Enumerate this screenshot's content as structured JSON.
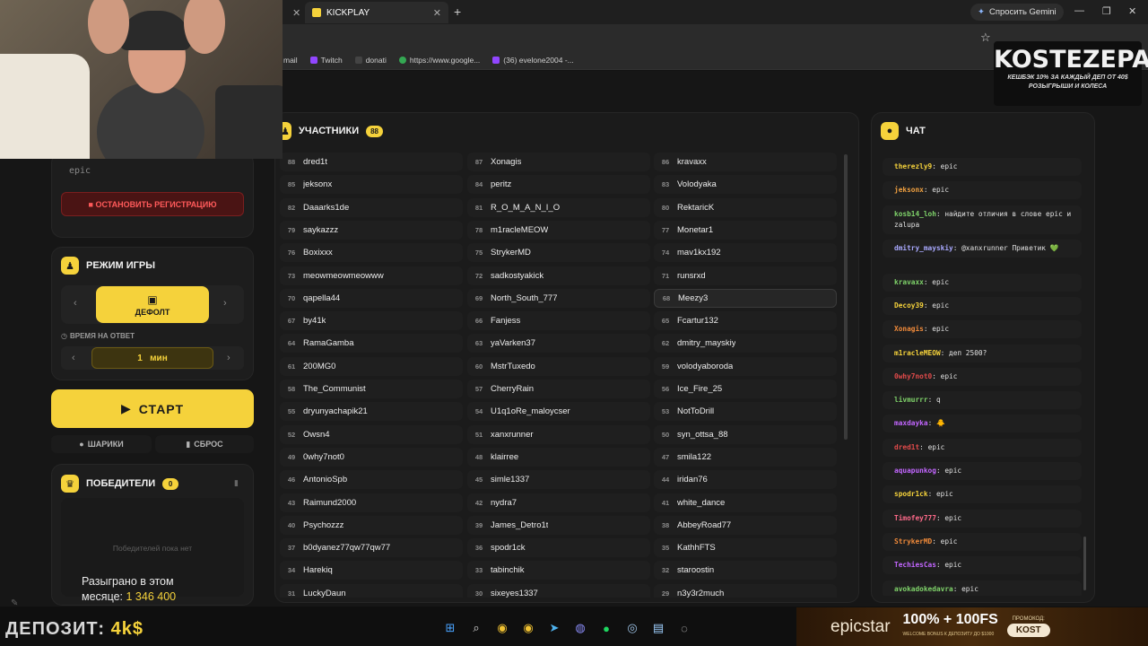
{
  "browser": {
    "tab_title": "KICKPLAY",
    "gemini_label": "Спросить Gemini",
    "bookmarks": [
      {
        "label": "mail"
      },
      {
        "label": "Twitch"
      },
      {
        "label": "donati"
      },
      {
        "label": "https://www.google..."
      },
      {
        "label": "(36) evelone2004 -..."
      }
    ]
  },
  "registration": {
    "last_message": "epic",
    "stop_label": "■ ОСТАНОВИТЬ РЕГИСТРАЦИЮ"
  },
  "game_mode": {
    "title": "РЕЖИМ ИГРЫ",
    "selected": "ДЕФОЛТ",
    "response_time_label": "ВРЕМЯ НА ОТВЕТ",
    "response_time": "1   мин"
  },
  "controls": {
    "start_label": "СТАРТ",
    "balls_label": "ШАРИКИ",
    "reset_label": "СБРОС"
  },
  "winners": {
    "title": "ПОБЕДИТЕЛИ",
    "count": "0",
    "empty_text": "Победителей пока нет",
    "played_line1": "Разыграно в этом",
    "played_line2": "месяце:",
    "played_amount": "1 346 400"
  },
  "participants": {
    "title": "УЧАСТНИКИ",
    "count": "88",
    "highlighted": "68",
    "rows": [
      [
        {
          "n": "88",
          "name": "dred1t"
        },
        {
          "n": "87",
          "name": "Xonagis"
        },
        {
          "n": "86",
          "name": "kravaxx"
        }
      ],
      [
        {
          "n": "85",
          "name": "jeksonx"
        },
        {
          "n": "84",
          "name": "peritz"
        },
        {
          "n": "83",
          "name": "Volodyaka"
        }
      ],
      [
        {
          "n": "82",
          "name": "Daaarks1de"
        },
        {
          "n": "81",
          "name": "R_O_M_A_N_I_O"
        },
        {
          "n": "80",
          "name": "RektaricK"
        }
      ],
      [
        {
          "n": "79",
          "name": "saykazzz"
        },
        {
          "n": "78",
          "name": "m1racleMEOW"
        },
        {
          "n": "77",
          "name": "Monetar1"
        }
      ],
      [
        {
          "n": "76",
          "name": "Boxixxx"
        },
        {
          "n": "75",
          "name": "StrykerMD"
        },
        {
          "n": "74",
          "name": "mav1kx192"
        }
      ],
      [
        {
          "n": "73",
          "name": "meowmeowmeowww"
        },
        {
          "n": "72",
          "name": "sadkostyakick"
        },
        {
          "n": "71",
          "name": "runsrxd"
        }
      ],
      [
        {
          "n": "70",
          "name": "qapella44"
        },
        {
          "n": "69",
          "name": "North_South_777"
        },
        {
          "n": "68",
          "name": "Meezy3"
        }
      ],
      [
        {
          "n": "67",
          "name": "by41k"
        },
        {
          "n": "66",
          "name": "Fanjess"
        },
        {
          "n": "65",
          "name": "Fcartur132"
        }
      ],
      [
        {
          "n": "64",
          "name": "RamaGamba"
        },
        {
          "n": "63",
          "name": "yaVarken37"
        },
        {
          "n": "62",
          "name": "dmitry_mayskiy"
        }
      ],
      [
        {
          "n": "61",
          "name": "200MG0"
        },
        {
          "n": "60",
          "name": "MstrTuxedo"
        },
        {
          "n": "59",
          "name": "volodyaboroda"
        }
      ],
      [
        {
          "n": "58",
          "name": "The_Communist"
        },
        {
          "n": "57",
          "name": "CherryRain"
        },
        {
          "n": "56",
          "name": "Ice_Fire_25"
        }
      ],
      [
        {
          "n": "55",
          "name": "dryunyachapik21"
        },
        {
          "n": "54",
          "name": "U1q1oRe_maloycser"
        },
        {
          "n": "53",
          "name": "NotToDrill"
        }
      ],
      [
        {
          "n": "52",
          "name": "Owsn4"
        },
        {
          "n": "51",
          "name": "xanxrunner"
        },
        {
          "n": "50",
          "name": "syn_ottsa_88"
        }
      ],
      [
        {
          "n": "49",
          "name": "0why7not0"
        },
        {
          "n": "48",
          "name": "klairree"
        },
        {
          "n": "47",
          "name": "smila122"
        }
      ],
      [
        {
          "n": "46",
          "name": "AntonioSpb"
        },
        {
          "n": "45",
          "name": "simle1337"
        },
        {
          "n": "44",
          "name": "iridan76"
        }
      ],
      [
        {
          "n": "43",
          "name": "Raimund2000"
        },
        {
          "n": "42",
          "name": "nydra7"
        },
        {
          "n": "41",
          "name": "white_dance"
        }
      ],
      [
        {
          "n": "40",
          "name": "Psychozzz"
        },
        {
          "n": "39",
          "name": "James_Detro1t"
        },
        {
          "n": "38",
          "name": "AbbeyRoad77"
        }
      ],
      [
        {
          "n": "37",
          "name": "b0dyanez77qw77qw77"
        },
        {
          "n": "36",
          "name": "spodr1ck"
        },
        {
          "n": "35",
          "name": "KathhFTS"
        }
      ],
      [
        {
          "n": "34",
          "name": "Harekiq"
        },
        {
          "n": "33",
          "name": "tabinchik"
        },
        {
          "n": "32",
          "name": "staroostin"
        }
      ],
      [
        {
          "n": "31",
          "name": "LuckyDaun"
        },
        {
          "n": "30",
          "name": "sixeyes1337"
        },
        {
          "n": "29",
          "name": "n3y3r2much"
        }
      ]
    ]
  },
  "chat": {
    "title": "ЧАТ",
    "messages": [
      {
        "user": "therezly9",
        "text": "epic",
        "color": "#f5d23b"
      },
      {
        "user": "jeksonx",
        "text": "epic",
        "color": "#f0a040"
      },
      {
        "user": "kosb14_loh",
        "text": "найдите отличия в слове epic и zalupa",
        "color": "#7fd36a"
      },
      {
        "user": "dmitry_mayskiy",
        "text": "@xanxrunner Приветик 💚",
        "color": "#a9a9ff"
      },
      {
        "user": "kravaxx",
        "text": "epic",
        "color": "#7fd36a"
      },
      {
        "user": "Decoy39",
        "text": "epic",
        "color": "#f5d23b"
      },
      {
        "user": "Xonagis",
        "text": "epic",
        "color": "#f08a3a"
      },
      {
        "user": "m1racleMEOW",
        "text": "деп 2500?",
        "color": "#f5d23b"
      },
      {
        "user": "0why7not0",
        "text": "epic",
        "color": "#e04a4a"
      },
      {
        "user": "livmurrr",
        "text": "q",
        "color": "#7fd36a"
      },
      {
        "user": "maxdayka",
        "text": "🐥",
        "color": "#c266ff"
      },
      {
        "user": "dred1t",
        "text": "epic",
        "color": "#e04a4a"
      },
      {
        "user": "aquapunkog",
        "text": "epic",
        "color": "#c266ff"
      },
      {
        "user": "spodr1ck",
        "text": "epic",
        "color": "#f5d23b"
      },
      {
        "user": "Timofey777",
        "text": "epic",
        "color": "#ff6a8a"
      },
      {
        "user": "StrykerMD",
        "text": "epic",
        "color": "#f08a3a"
      },
      {
        "user": "TechiesCas",
        "text": "epic",
        "color": "#c266ff"
      },
      {
        "user": "avokadokedavra",
        "text": "epic",
        "color": "#7fd36a"
      }
    ]
  },
  "overlays": {
    "kost_title": "KOSTEZEPAY",
    "kost_sub1": "КЕШБЭК 10% ЗА КАЖДЫЙ ДЕП ОТ 40$",
    "kost_sub2": "РОЗЫГРЫШИ И КОЛЕСА",
    "deposit_label": "ДЕПОЗИТ:",
    "deposit_value": "4k$",
    "epicstar_logo": "epicstar",
    "epicstar_offer": "100% + 100FS",
    "epicstar_sub": "WELCOME BONUS К ДЕПОЗИТУ ДО $1000",
    "promo_label": "ПРОМОКОД:",
    "promo_code": "KOST"
  },
  "colors": {
    "accent": "#f5d23b",
    "danger": "#ff5a5a",
    "panel": "#1d1d1d"
  }
}
